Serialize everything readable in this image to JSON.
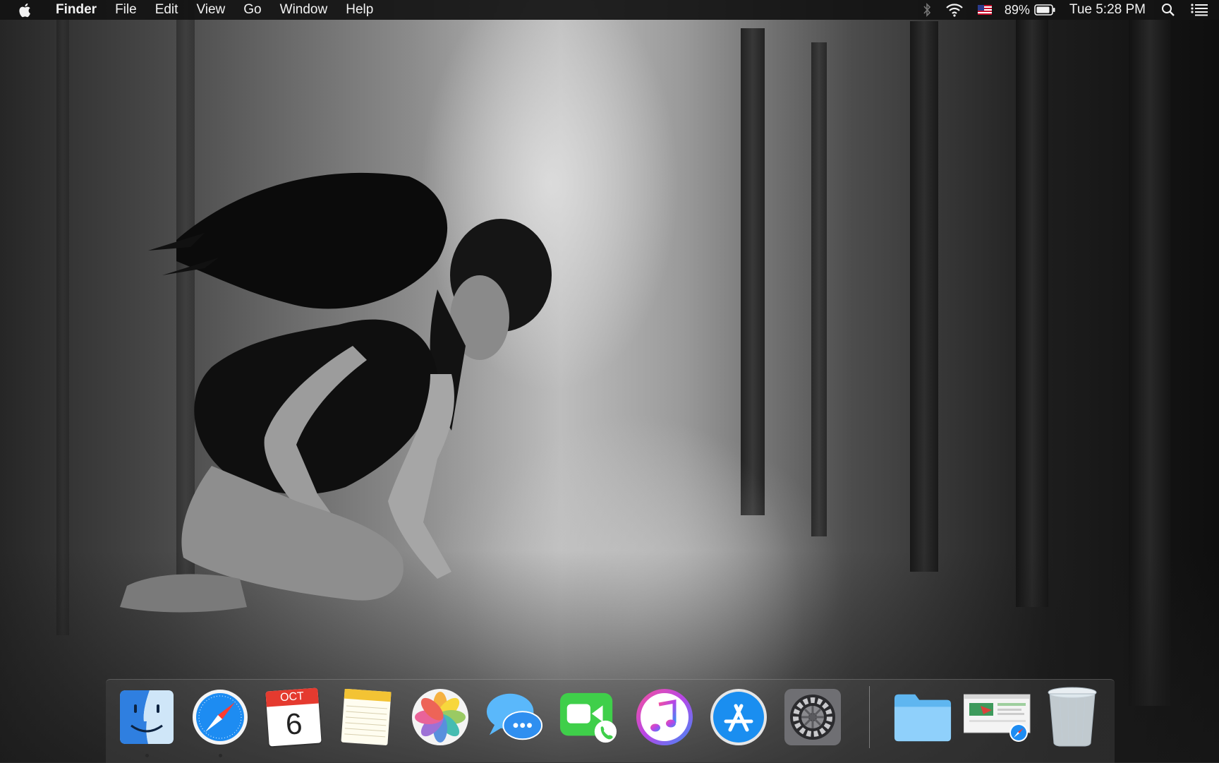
{
  "menubar": {
    "app_name": "Finder",
    "menus": [
      "File",
      "Edit",
      "View",
      "Go",
      "Window",
      "Help"
    ],
    "battery_percent": "89%",
    "clock": "Tue 5:28 PM",
    "status_icons": [
      "bluetooth-icon",
      "wifi-icon",
      "us-flag-input-icon",
      "battery-icon",
      "spotlight-search-icon",
      "notification-center-icon"
    ]
  },
  "dock": {
    "apps": [
      {
        "name": "Finder",
        "icon": "finder-icon"
      },
      {
        "name": "Safari",
        "icon": "safari-icon"
      },
      {
        "name": "Calendar",
        "icon": "calendar-icon",
        "month": "OCT",
        "day": "6"
      },
      {
        "name": "Notes",
        "icon": "notes-icon"
      },
      {
        "name": "Photos",
        "icon": "photos-icon"
      },
      {
        "name": "Messages",
        "icon": "messages-icon"
      },
      {
        "name": "FaceTime",
        "icon": "facetime-icon"
      },
      {
        "name": "iTunes",
        "icon": "itunes-icon"
      },
      {
        "name": "App Store",
        "icon": "app-store-icon"
      },
      {
        "name": "System Preferences",
        "icon": "system-preferences-icon"
      }
    ],
    "others": [
      {
        "name": "Downloads folder",
        "icon": "folder-icon"
      },
      {
        "name": "Safari window",
        "icon": "minimized-window-icon"
      },
      {
        "name": "Trash",
        "icon": "trash-icon"
      }
    ],
    "colors": {
      "finder_blue": "#2f7fe0",
      "safari_blue": "#1d8cf2",
      "facetime_green": "#3fcf4a",
      "messages_blue": "#2f9bf6"
    }
  }
}
